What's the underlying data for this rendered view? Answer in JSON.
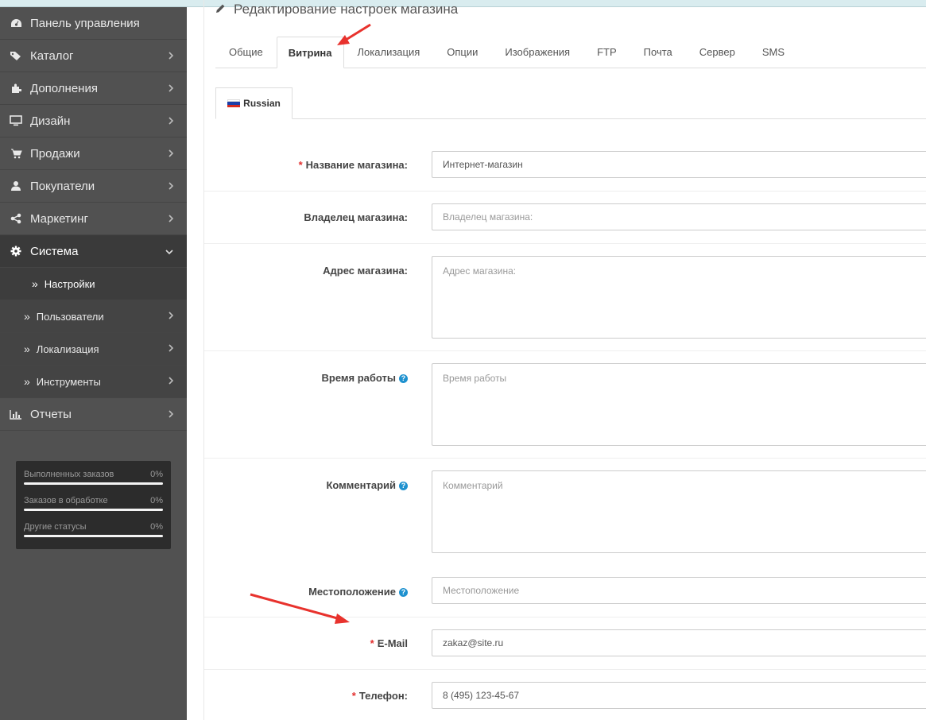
{
  "page_title": "Редактирование настроек магазина",
  "sidebar": {
    "items": [
      {
        "label": "Панель управления",
        "icon": "dashboard-icon",
        "has_chevron": false
      },
      {
        "label": "Каталог",
        "icon": "tags-icon",
        "has_chevron": true
      },
      {
        "label": "Дополнения",
        "icon": "puzzle-icon",
        "has_chevron": true
      },
      {
        "label": "Дизайн",
        "icon": "monitor-icon",
        "has_chevron": true
      },
      {
        "label": "Продажи",
        "icon": "cart-icon",
        "has_chevron": true
      },
      {
        "label": "Покупатели",
        "icon": "user-icon",
        "has_chevron": true
      },
      {
        "label": "Маркетинг",
        "icon": "share-icon",
        "has_chevron": true
      },
      {
        "label": "Система",
        "icon": "gear-icon",
        "has_chevron": true,
        "expanded": true
      }
    ],
    "subitems": [
      {
        "label": "Настройки",
        "current": true
      },
      {
        "label": "Пользователи",
        "has_chevron": true
      },
      {
        "label": "Локализация",
        "has_chevron": true
      },
      {
        "label": "Инструменты",
        "has_chevron": true
      }
    ],
    "reports": {
      "label": "Отчеты",
      "icon": "bar-chart-icon"
    },
    "stats": [
      {
        "label": "Выполненных заказов",
        "percent": "0%",
        "value": 0
      },
      {
        "label": "Заказов в обработке",
        "percent": "0%",
        "value": 0
      },
      {
        "label": "Другие статусы",
        "percent": "0%",
        "value": 0
      }
    ]
  },
  "tabs": [
    "Общие",
    "Витрина",
    "Локализация",
    "Опции",
    "Изображения",
    "FTP",
    "Почта",
    "Сервер",
    "SMS"
  ],
  "active_tab": "Витрина",
  "language_tab": "Russian",
  "form": {
    "store_name": {
      "label": "Название магазина:",
      "required": true,
      "value": "Интернет-магазин"
    },
    "owner": {
      "label": "Владелец магазина:",
      "placeholder": "Владелец магазина:"
    },
    "address": {
      "label": "Адрес магазина:",
      "placeholder": "Адрес магазина:"
    },
    "hours": {
      "label": "Время работы",
      "placeholder": "Время работы",
      "help": true
    },
    "comment": {
      "label": "Комментарий",
      "placeholder": "Комментарий",
      "help": true
    },
    "location": {
      "label": "Местоположение",
      "placeholder": "Местоположение",
      "help": true
    },
    "email": {
      "label": "E-Mail",
      "required": true,
      "value": "zakaz@site.ru"
    },
    "phone": {
      "label": "Телефон:",
      "required": true,
      "value": "8 (495) 123-45-67"
    }
  },
  "colors": {
    "sidebar": "#515151",
    "required": "#e3302f",
    "help": "#1e91cf",
    "annotation_arrow": "#e8322d"
  }
}
